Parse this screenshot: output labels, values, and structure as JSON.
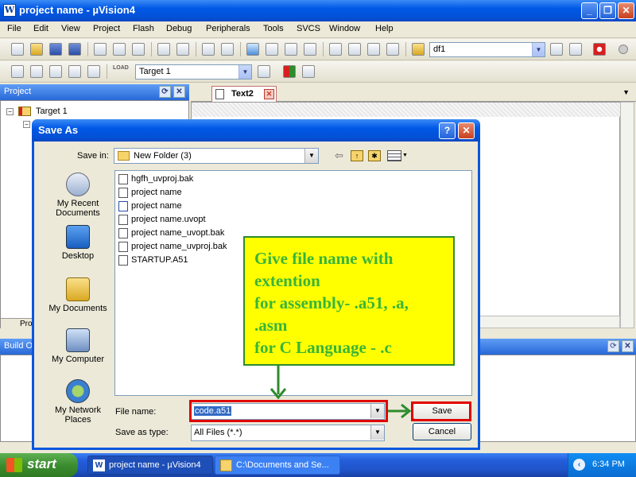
{
  "window": {
    "title": "project name  - µVision4",
    "icon": "W",
    "controls": {
      "minimize": "_",
      "maximize": "❐",
      "close": "✕"
    }
  },
  "menu": [
    "File",
    "Edit",
    "View",
    "Project",
    "Flash",
    "Debug",
    "Peripherals",
    "Tools",
    "SVCS",
    "Window",
    "Help"
  ],
  "toolbar1": {
    "find_combo_value": "df1"
  },
  "toolbar2": {
    "target_combo_value": "Target 1",
    "load_label": "LOAD"
  },
  "project_panel": {
    "title": "Project",
    "tree_root": "Target 1",
    "tab_label": "Pro"
  },
  "editor": {
    "tab_label": "Text2"
  },
  "build_panel": {
    "title": "Build O"
  },
  "dialog": {
    "title": "Save As",
    "help_btn": "?",
    "close_btn": "✕",
    "save_in_label": "Save in:",
    "save_in_value": "New Folder (3)",
    "places": [
      {
        "label_line1": "My Recent",
        "label_line2": "Documents",
        "icon": "recent-documents-icon"
      },
      {
        "label_line1": "Desktop",
        "label_line2": "",
        "icon": "desktop-icon"
      },
      {
        "label_line1": "My Documents",
        "label_line2": "",
        "icon": "my-documents-icon"
      },
      {
        "label_line1": "My Computer",
        "label_line2": "",
        "icon": "my-computer-icon"
      },
      {
        "label_line1": "My Network",
        "label_line2": "Places",
        "icon": "network-places-icon"
      }
    ],
    "files": [
      "hgfh_uvproj.bak",
      "project name",
      "project name",
      "project name.uvopt",
      "project name_uvopt.bak",
      "project name_uvproj.bak",
      "STARTUP.A51"
    ],
    "file_name_label": "File name:",
    "file_name_value": "code.a51",
    "save_as_type_label": "Save as type:",
    "save_as_type_value": "All Files (*.*)",
    "save_button": "Save",
    "cancel_button": "Cancel"
  },
  "annotation": {
    "lines": [
      "Give file name with",
      "extention",
      "for assembly- .a51, .a,",
      ".asm",
      "for C Language - .c"
    ],
    "text_color": "#39b539",
    "background": "#ffff00",
    "highlight_color": "#e00000"
  },
  "taskbar": {
    "start_label": "start",
    "items": [
      "project name  - µVision4",
      "C:\\Documents and Se..."
    ],
    "clock": "6:34 PM"
  }
}
